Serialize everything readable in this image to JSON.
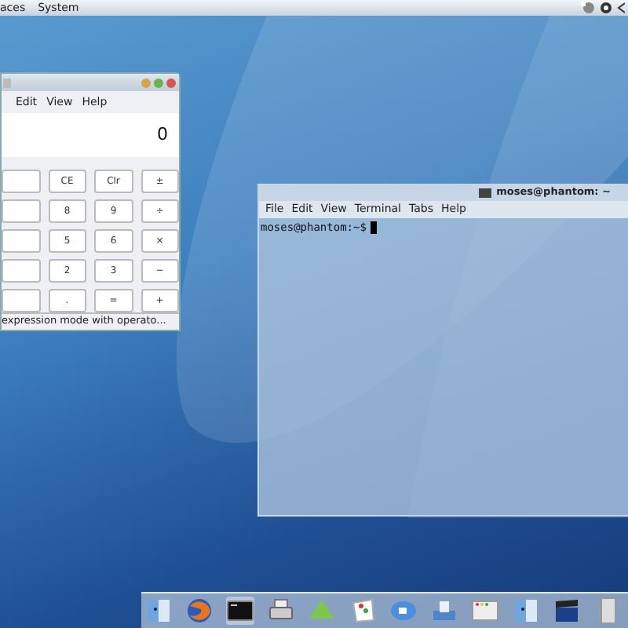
{
  "top_panel": {
    "menus": [
      "aces",
      "System"
    ]
  },
  "calculator": {
    "menus": [
      "Edit",
      "View",
      "Help"
    ],
    "display": "0",
    "buttons": [
      [
        "CE",
        "Clr",
        "±"
      ],
      [
        "8",
        "9",
        "÷"
      ],
      [
        "5",
        "6",
        "×"
      ],
      [
        "2",
        "3",
        "−"
      ],
      [
        ".",
        "=",
        "+"
      ]
    ],
    "status_bar": "expression mode with operato..."
  },
  "terminal": {
    "title": "moses@phantom: ~",
    "menus": [
      "File",
      "Edit",
      "View",
      "Terminal",
      "Tabs",
      "Help"
    ],
    "prompt": "moses@phantom:~$"
  },
  "dock": {
    "items": [
      {
        "kind": "finder"
      },
      {
        "kind": "browser"
      },
      {
        "kind": "terminal",
        "selected": true
      },
      {
        "kind": "printer"
      },
      {
        "kind": "gem"
      },
      {
        "kind": "cards"
      },
      {
        "kind": "chat"
      },
      {
        "kind": "upload"
      },
      {
        "kind": "window"
      },
      {
        "kind": "finder"
      },
      {
        "kind": "clapper"
      },
      {
        "kind": "panel"
      }
    ]
  }
}
